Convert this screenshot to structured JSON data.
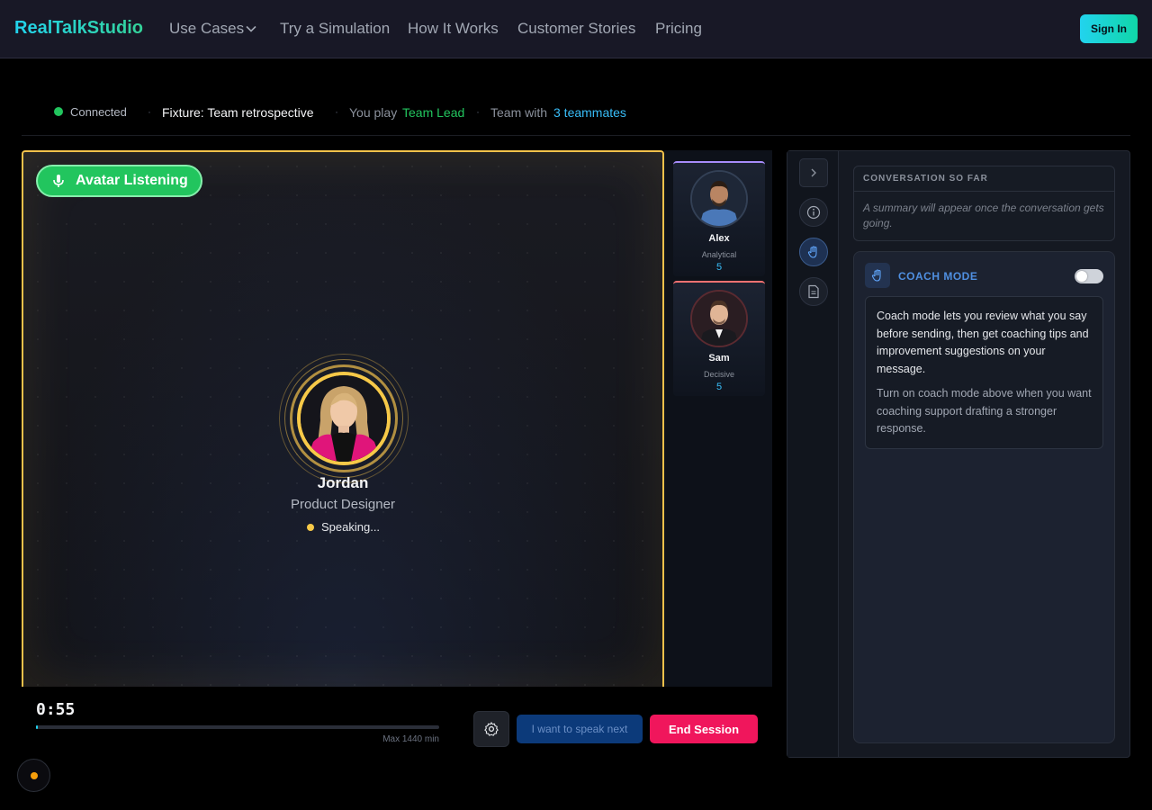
{
  "nav": {
    "brand": "RealTalkStudio",
    "links": [
      "Use Cases",
      "Try a Simulation",
      "How It Works",
      "Customer Stories",
      "Pricing"
    ],
    "signin_label": "Sign In"
  },
  "status": {
    "connection": "Connected",
    "fixture": "Fixture: Team retrospective",
    "you_play_prefix": "You play",
    "role": "Team Lead",
    "team_prefix": "Team with",
    "teammates": "3 teammates",
    "separator": "·"
  },
  "stage": {
    "badge_label": "Avatar Listening",
    "lead": {
      "name": "Jordan",
      "role": "Product Designer",
      "state": "Speaking..."
    }
  },
  "teammates": [
    {
      "name": "Alex",
      "trait": "Analytical",
      "score": "5",
      "accent": "#a78bfa"
    },
    {
      "name": "Sam",
      "trait": "Decisive",
      "score": "5",
      "accent": "#f87171"
    }
  ],
  "controls": {
    "timer": "0:55",
    "progress": 0.005,
    "max_label": "Max 1440 min",
    "speak_next_label": "I want to speak next",
    "end_label": "End Session"
  },
  "panel": {
    "summary_title": "CONVERSATION SO FAR",
    "summary_text": "A summary will appear once the conversation gets going.",
    "coach_title": "COACH MODE",
    "coach_enabled": false,
    "coach_p1": "Coach mode lets you review what you say before sending, then get coaching tips and improvement suggestions on your message.",
    "coach_p2": "Turn on coach mode above when you want coaching support drafting a stronger response."
  },
  "colors": {
    "accent_teal": "#22d3ee",
    "listen_green": "#22c55e",
    "speaking_gold": "#f7c948",
    "end_pink": "#f0165c",
    "coach_blue": "#4f8fe0"
  }
}
